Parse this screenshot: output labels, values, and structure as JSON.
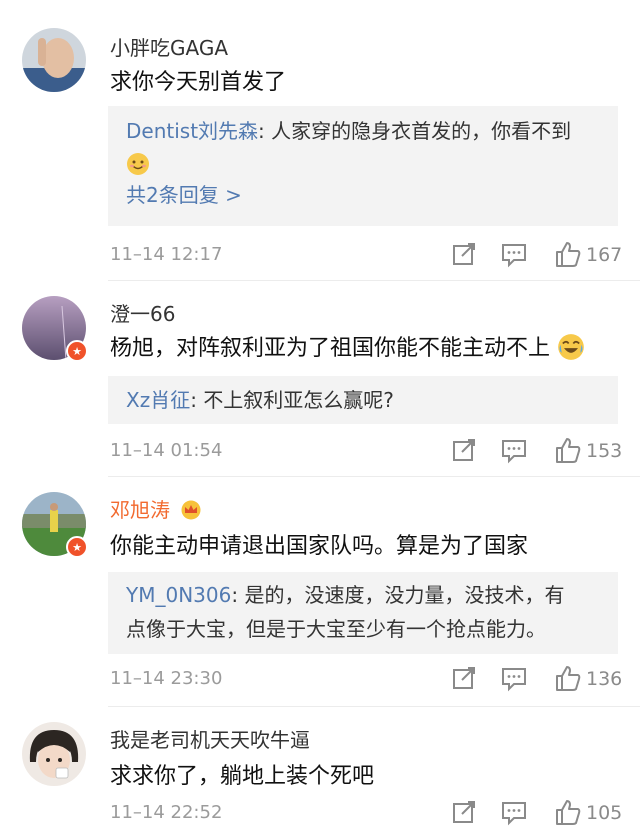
{
  "comments": [
    {
      "user": "小胖吃GAGA",
      "text": "求你今天别首发了",
      "reply_user": "Dentist刘先森",
      "reply_text": "人家穿的隐身衣首发的，你看不到",
      "more_replies": "共2条回复 >",
      "time": "11–14 12:17",
      "likes": "167"
    },
    {
      "user": "澄一66",
      "text": "杨旭，对阵叙利亚为了祖国你能不能主动不上",
      "reply_user": "Xz肖征",
      "reply_text": "不上叙利亚怎么赢呢?",
      "time": "11–14 01:54",
      "likes": "153"
    },
    {
      "user": "邓旭涛",
      "text": "你能主动申请退出国家队吗。算是为了国家",
      "reply_user": "YM_0N306",
      "reply_line1": "是的，没速度，没力量，没技术，有",
      "reply_line2": "点像于大宝，但是于大宝至少有一个抢点能力。",
      "time": "11–14 23:30",
      "likes": "136"
    },
    {
      "user": "我是老司机天天吹牛逼",
      "text": "求求你了，躺地上装个死吧",
      "time": "11–14 22:52",
      "likes": "105"
    }
  ],
  "colors": {
    "link_blue": "#527ab1",
    "vip_orange": "#f26a2f",
    "reply_bg": "#f3f3f3",
    "meta_gray": "#9b9b9b"
  },
  "icons": [
    "share-icon",
    "comment-icon",
    "like-icon",
    "smile-emoji-icon",
    "laugh-cry-emoji-icon",
    "crown-icon",
    "verified-badge-icon"
  ]
}
